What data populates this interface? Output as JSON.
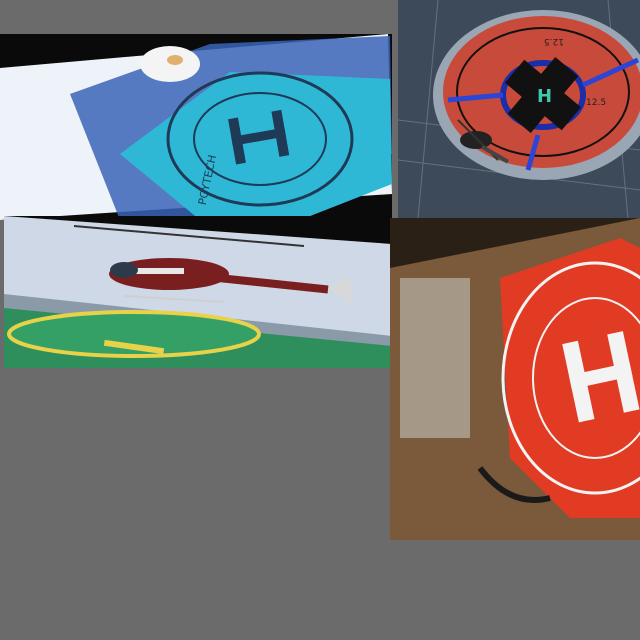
{
  "canvas": {
    "background": "#6b6b6b"
  },
  "tiles": [
    {
      "name": "helipad-mat-cyan",
      "subject": "Cyan folding helipad mat with H marking on a white surface",
      "colors": {
        "mat": "#2fb8d6",
        "surface": "#f2f6fb",
        "shadow": "#2a4f9c",
        "ink": "#1e3a56"
      },
      "marking": "H",
      "mat_brand_text": "PGYTECH"
    },
    {
      "name": "rooftop-helipad-aerial",
      "subject": "Aerial view of a rooftop helipad with a helicopter and a black cross marking",
      "colors": {
        "pad": "#c84a3a",
        "ring": "#1b2ea8",
        "cross": "#111111",
        "stripe": "#2b45d6",
        "h_mark": "#3fc9a8"
      },
      "marking": "H",
      "pad_numbers": [
        "12.5",
        "12.5"
      ]
    },
    {
      "name": "helicopter-landing-rooftop",
      "subject": "Red and white helicopter landing on a green rooftop helipad",
      "colors": {
        "sky": "#cfd8e6",
        "pad": "#2e8f5c",
        "ring": "#e8d24a",
        "body": "#7a1f1f",
        "trim": "#e7e7e7"
      }
    },
    {
      "name": "helipad-mat-orange",
      "subject": "Orange helipad mat with white H marking lying on a wooden floor",
      "colors": {
        "mat": "#e23b24",
        "mark": "#f3f3f3",
        "floor": "#7a5a3a",
        "dark": "#2a2016"
      },
      "marking": "H"
    }
  ]
}
